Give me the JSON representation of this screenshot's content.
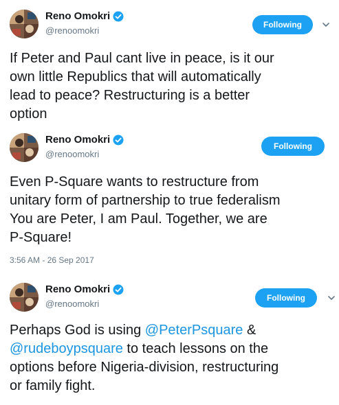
{
  "tweets": [
    {
      "author": "Reno Omokri",
      "handle": "@renoomokri",
      "follow_label": "Following",
      "text": "If Peter and Paul cant live in peace, is it our\nown little Republics that will automatically\nlead to peace? Restructuring is a better\noption"
    },
    {
      "author": "Reno Omokri",
      "handle": "@renoomokri",
      "follow_label": "Following",
      "text": "Even P-Square wants to restructure from\nunitary form of partnership to true federalism\nYou are Peter, I am Paul. Together, we are\nP-Square!",
      "timestamp": "3:56 AM - 26 Sep 2017"
    },
    {
      "author": "Reno Omokri",
      "handle": "@renoomokri",
      "follow_label": "Following",
      "text_parts": {
        "p1": "Perhaps God is using ",
        "mention1": "@PeterPsquare",
        "p2": " &\n",
        "mention2": "@rudeboypsquare",
        "p3": " to teach lessons on the\noptions before Nigeria-division, restructuring\nor family fight."
      }
    }
  ],
  "colors": {
    "accent": "#1da1f2",
    "mention": "#1b95e0",
    "muted": "#657786",
    "text": "#14171a"
  },
  "icons": {
    "verified": "verified-badge-icon",
    "chevron": "chevron-down-icon"
  }
}
